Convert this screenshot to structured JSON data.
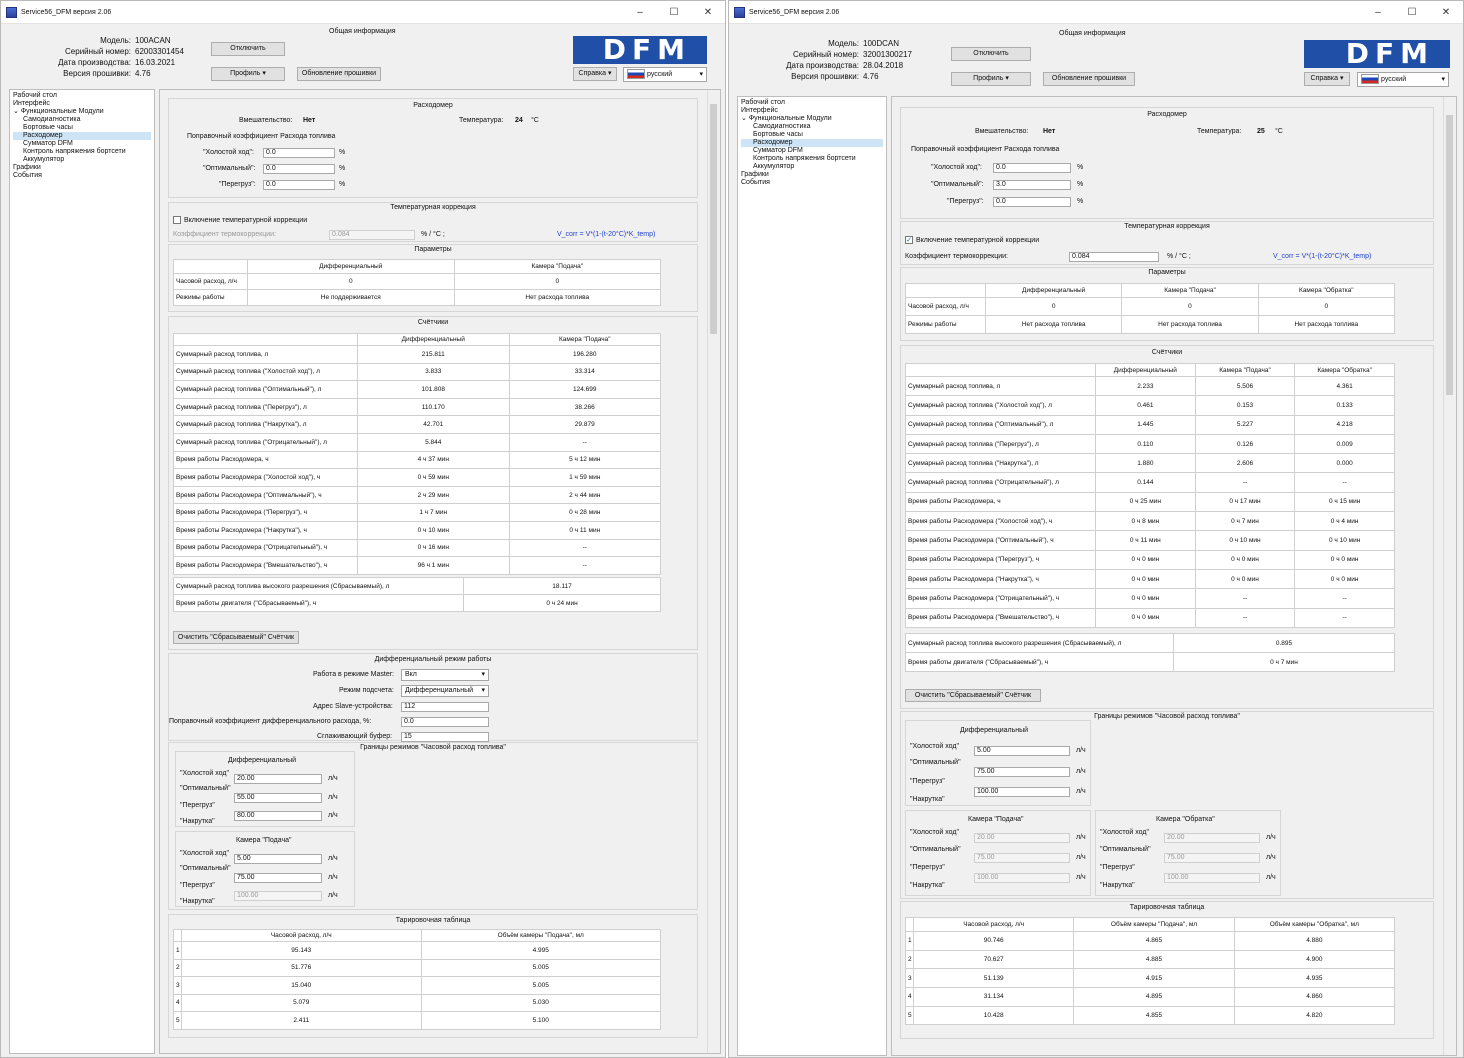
{
  "w1": {
    "title": "Service56_DFM версия 2.06",
    "model_label": "Модель:",
    "model": "100ACAN",
    "serial_label": "Серийный номер:",
    "serial": "62003301454",
    "date_label": "Дата производства:",
    "date": "16.03.2021",
    "fw_label": "Версия прошивки:",
    "fw": "4.76",
    "general_info": "Общая информация",
    "disconnect": "Отключить",
    "profile": "Профиль",
    "update_fw": "Обновление прошивки",
    "help": "Справка",
    "language": "русский",
    "logo": "DFM",
    "tree": [
      "Рабочий стол",
      "Интерфейс",
      "Функциональные Модули",
      "Самодиагностика",
      "Бортовые часы",
      "Расходомер",
      "Сумматор DFM",
      "Контроль напряжения бортсети",
      "Аккумулятор",
      "Графики",
      "События"
    ],
    "flowmeter_title": "Расходомер",
    "tamper_label": "Вмешательство:",
    "tamper": "Нет",
    "temp_label": "Температура:",
    "temp": "24",
    "temp_unit": "°С",
    "corr_title": "Поправочный коэффициент Расхода топлива",
    "idle_label": "\"Холостой ход\":",
    "idle": "0.0",
    "opt_label": "\"Оптимальный\":",
    "opt": "0.0",
    "over_label": "\"Перегруз\":",
    "over": "0.0",
    "pct": "%",
    "tempcorr_title": "Температурная коррекция",
    "tempcorr_enable": "Включение температурной коррекции",
    "tempcorr_coef_label": "Коэффициент термокоррекции:",
    "tempcorr_coef": "0.084",
    "tempcorr_unit": "% / °С ;",
    "formula": "V_corr = V*(1-(t-20°C)*K_temp)",
    "params_title": "Параметры",
    "params": {
      "headers": [
        "",
        "Дифференциальный",
        "Камера \"Подача\""
      ],
      "rows": [
        [
          "Часовой расход, л/ч",
          "0",
          "0"
        ],
        [
          "Режимы работы",
          "Не поддерживается",
          "Нет расхода топлива"
        ]
      ]
    },
    "counters_title": "Счётчики",
    "counters": {
      "headers": [
        "",
        "Дифференциальный",
        "Камера \"Подача\""
      ],
      "rows": [
        [
          "Суммарный расход топлива, л",
          "215.811",
          "196.280"
        ],
        [
          "Суммарный расход топлива (\"Холостой ход\"), л",
          "3.833",
          "33.314"
        ],
        [
          "Суммарный расход топлива (\"Оптимальный\"), л",
          "101.808",
          "124.699"
        ],
        [
          "Суммарный расход топлива (\"Перегруз\"), л",
          "110.170",
          "38.266"
        ],
        [
          "Суммарный расход топлива (\"Накрутка\"), л",
          "42.701",
          "29.879"
        ],
        [
          "Суммарный расход топлива (\"Отрицательный\"), л",
          "5.844",
          "--"
        ],
        [
          "Время работы Расходомера, ч",
          "4 ч 37 мин",
          "5 ч 12 мин"
        ],
        [
          "Время работы Расходомера (\"Холостой ход\"), ч",
          "0 ч 59 мин",
          "1 ч 59 мин"
        ],
        [
          "Время работы Расходомера (\"Оптимальный\"), ч",
          "2 ч 29 мин",
          "2 ч 44 мин"
        ],
        [
          "Время работы Расходомера (\"Перегруз\"), ч",
          "1 ч 7 мин",
          "0 ч 28 мин"
        ],
        [
          "Время работы Расходомера (\"Накрутка\"), ч",
          "0 ч 10 мин",
          "0 ч 11 мин"
        ],
        [
          "Время работы Расходомера (\"Отрицательный\"), ч",
          "0 ч 16 мин",
          "--"
        ],
        [
          "Время работы Расходомера (\"Вмешательство\"), ч",
          "96 ч 1 мин",
          "--"
        ]
      ]
    },
    "reset": {
      "rows": [
        [
          "Суммарный расход топлива высокого разрешения (Сбрасываемый), л",
          "18.117"
        ],
        [
          "Время работы двигателя (\"Сбрасываемый\"), ч",
          "0 ч 24 мин"
        ]
      ]
    },
    "clear_btn": "Очистить \"Сбрасываемый\" Счётчик",
    "diff_title": "Дифференциальный режим работы",
    "master_label": "Работа в режиме Master:",
    "master": "Вкл",
    "calc_label": "Режим подсчета:",
    "calc": "Дифференциальный",
    "slave_label": "Адрес Slave-устройства:",
    "slave": "112",
    "diffcorr_label": "Поправочный коэффициент дифференциального расхода, %:",
    "diffcorr": "0.0",
    "smooth_label": "Сглаживающий буфер:",
    "smooth": "15",
    "bounds_title": "Границы режимов \"Часовой расход топлива\"",
    "diff_group": "Дифференциальный",
    "supply_group": "Камера \"Подача\"",
    "b_idle": "\"Холостой ход\"",
    "b_opt": "\"Оптимальный\"",
    "b_over": "\"Перегруз\"",
    "b_nak": "\"Накрутка\"",
    "unit_lh": "л/ч",
    "diff_vals": [
      "20.00",
      "55.00",
      "80.00"
    ],
    "supply_vals": [
      "5.00",
      "75.00",
      "100.00"
    ],
    "tar_title": "Тарировочная таблица",
    "tar": {
      "headers": [
        "",
        "Часовой расход, л/ч",
        "Объём камеры \"Подача\", мл"
      ],
      "rows": [
        [
          "1",
          "95.143",
          "4.995"
        ],
        [
          "2",
          "51.776",
          "5.005"
        ],
        [
          "3",
          "15.040",
          "5.005"
        ],
        [
          "4",
          "5.079",
          "5.030"
        ],
        [
          "5",
          "2.411",
          "5.100"
        ]
      ]
    }
  },
  "w2": {
    "title": "Service56_DFM версия 2.06",
    "model_label": "Модель:",
    "model": "100DCAN",
    "serial_label": "Серийный номер:",
    "serial": "32001300217",
    "date_label": "Дата производства:",
    "date": "28.04.2018",
    "fw_label": "Версия прошивки:",
    "fw": "4.76",
    "general_info": "Общая информация",
    "disconnect": "Отключить",
    "profile": "Профиль",
    "update_fw": "Обновление прошивки",
    "help": "Справка",
    "language": "русский",
    "logo": "DFM",
    "tree": [
      "Рабочий стол",
      "Интерфейс",
      "Функциональные Модули",
      "Самодиагностика",
      "Бортовые часы",
      "Расходомер",
      "Сумматор DFM",
      "Контроль напряжения бортсети",
      "Аккумулятор",
      "Графики",
      "События"
    ],
    "flowmeter_title": "Расходомер",
    "tamper_label": "Вмешательство:",
    "tamper": "Нет",
    "temp_label": "Температура:",
    "temp": "25",
    "temp_unit": "°С",
    "corr_title": "Поправочный коэффициент Расхода топлива",
    "idle_label": "\"Холостой ход\":",
    "idle": "0.0",
    "opt_label": "\"Оптимальный\":",
    "opt": "3.0",
    "over_label": "\"Перегруз\":",
    "over": "0.0",
    "pct": "%",
    "tempcorr_title": "Температурная коррекция",
    "tempcorr_enable": "Включение температурной коррекции",
    "tempcorr_coef_label": "Коэффициент термокоррекции:",
    "tempcorr_coef": "0.084",
    "tempcorr_unit": "% / °С ;",
    "formula": "V_corr = V*(1-(t-20°C)*K_temp)",
    "params_title": "Параметры",
    "params": {
      "headers": [
        "",
        "Дифференциальный",
        "Камера \"Подача\"",
        "Камера \"Обратка\""
      ],
      "rows": [
        [
          "Часовой расход, л/ч",
          "0",
          "0",
          "0"
        ],
        [
          "Режимы работы",
          "Нет расхода топлива",
          "Нет расхода топлива",
          "Нет расхода топлива"
        ]
      ]
    },
    "counters_title": "Счётчики",
    "counters": {
      "headers": [
        "",
        "Дифференциальный",
        "Камера \"Подача\"",
        "Камера \"Обратка\""
      ],
      "rows": [
        [
          "Суммарный расход топлива, л",
          "2.233",
          "5.506",
          "4.361"
        ],
        [
          "Суммарный расход топлива (\"Холостой ход\"), л",
          "0.461",
          "0.153",
          "0.133"
        ],
        [
          "Суммарный расход топлива (\"Оптимальный\"), л",
          "1.445",
          "5.227",
          "4.218"
        ],
        [
          "Суммарный расход топлива (\"Перегруз\"), л",
          "0.110",
          "0.126",
          "0.009"
        ],
        [
          "Суммарный расход топлива (\"Накрутка\"), л",
          "1.880",
          "2.606",
          "0.000"
        ],
        [
          "Суммарный расход топлива (\"Отрицательный\"), л",
          "0.144",
          "--",
          "--"
        ],
        [
          "Время работы Расходомера, ч",
          "0 ч 25 мин",
          "0 ч 17 мин",
          "0 ч 15 мин"
        ],
        [
          "Время работы Расходомера (\"Холостой ход\"), ч",
          "0 ч 8 мин",
          "0 ч 7 мин",
          "0 ч 4 мин"
        ],
        [
          "Время работы Расходомера (\"Оптимальный\"), ч",
          "0 ч 11 мин",
          "0 ч 10 мин",
          "0 ч 10 мин"
        ],
        [
          "Время работы Расходомера (\"Перегруз\"), ч",
          "0 ч 0 мин",
          "0 ч 0 мин",
          "0 ч 0 мин"
        ],
        [
          "Время работы Расходомера (\"Накрутка\"), ч",
          "0 ч 0 мин",
          "0 ч 0 мин",
          "0 ч 0 мин"
        ],
        [
          "Время работы Расходомера (\"Отрицательный\"), ч",
          "0 ч 0 мин",
          "--",
          "--"
        ],
        [
          "Время работы Расходомера (\"Вмешательство\"), ч",
          "0 ч 0 мин",
          "--",
          "--"
        ]
      ]
    },
    "reset": {
      "rows": [
        [
          "Суммарный расход топлива высокого разрешения (Сбрасываемый), л",
          "0.895"
        ],
        [
          "Время работы двигателя (\"Сбрасываемый\"), ч",
          "0 ч 7 мин"
        ]
      ]
    },
    "clear_btn": "Очистить \"Сбрасываемый\" Счётчик",
    "bounds_title": "Границы режимов \"Часовой расход топлива\"",
    "diff_group": "Дифференциальный",
    "supply_group": "Камера \"Подача\"",
    "return_group": "Камера \"Обратка\"",
    "b_idle": "\"Холостой ход\"",
    "b_opt": "\"Оптимальный\"",
    "b_over": "\"Перегруз\"",
    "b_nak": "\"Накрутка\"",
    "unit_lh": "л/ч",
    "diff_vals": [
      "5.00",
      "75.00",
      "100.00"
    ],
    "supply_vals": [
      "20.00",
      "75.00",
      "100.00"
    ],
    "return_vals": [
      "20.00",
      "75.00",
      "100.00"
    ],
    "tar_title": "Тарировочная таблица",
    "tar": {
      "headers": [
        "",
        "Часовой расход, л/ч",
        "Объём камеры \"Подача\", мл",
        "Объём камеры \"Обратка\", мл"
      ],
      "rows": [
        [
          "1",
          "90.746",
          "4.865",
          "4.880"
        ],
        [
          "2",
          "70.627",
          "4.885",
          "4.900"
        ],
        [
          "3",
          "51.139",
          "4.915",
          "4.935"
        ],
        [
          "4",
          "31.134",
          "4.895",
          "4.860"
        ],
        [
          "5",
          "10.428",
          "4.855",
          "4.820"
        ]
      ]
    }
  }
}
